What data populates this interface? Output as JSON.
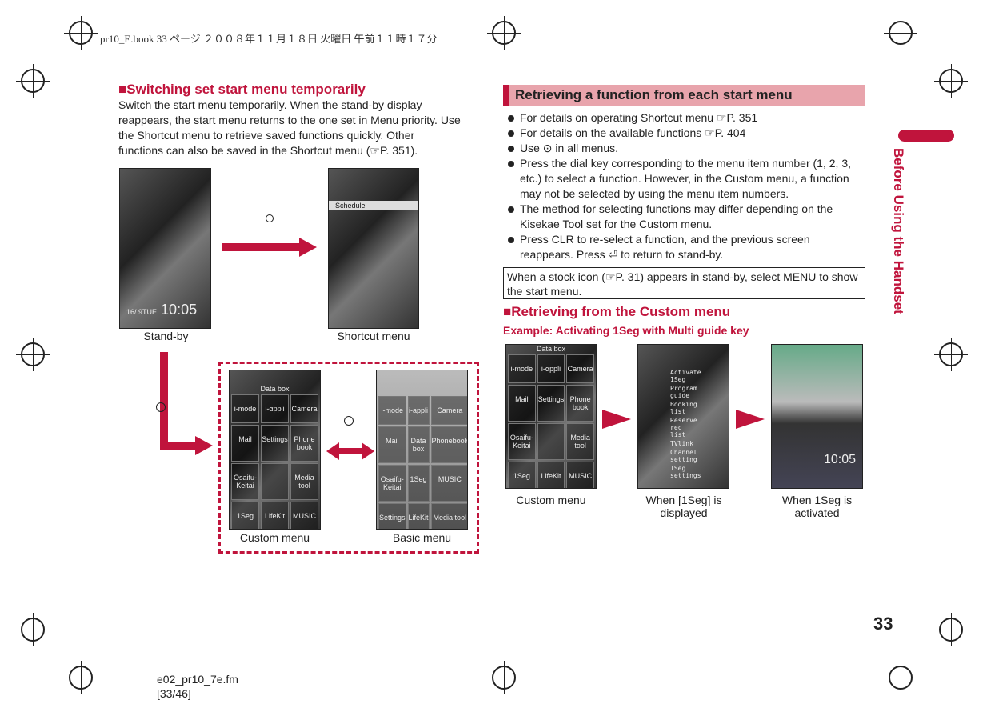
{
  "header": "pr10_E.book  33 ページ  ２００８年１１月１８日  火曜日  午前１１時１７分",
  "left": {
    "title": "■Switching set start menu temporarily",
    "body": "Switch the start menu temporarily. When the stand-by display reappears, the start menu returns to the one set in Menu priority. Use the Shortcut menu to retrieve saved functions quickly. Other functions can also be saved in the Shortcut menu (☞P. 351).",
    "captions": [
      "Stand-by",
      "Shortcut menu",
      "Custom menu",
      "Basic menu"
    ],
    "standby_time": "10:05",
    "standby_date": "16/ 9TUE",
    "shortcut_title": "Schedule",
    "custom_items": [
      "i-mode",
      "i-αppli",
      "Camera",
      "Mail",
      "Settings",
      "Phone book",
      "Osaifu-Keitai",
      "",
      "Media tool",
      "1Seg",
      "LifeKit",
      "MUSIC"
    ],
    "custom_header": "Data box",
    "basic_items": [
      "i-mode",
      "i-appli",
      "Camera",
      "Mail",
      "Data box",
      "Phonebook",
      "Osaifu-Keitai",
      "1Seg",
      "MUSIC",
      "Settings",
      "LifeKit",
      "Media tool"
    ]
  },
  "right": {
    "title": "Retrieving a function from each start menu",
    "bullets": [
      "For details on operating Shortcut menu ☞P. 351",
      "For details on the available functions ☞P. 404",
      "Use ⊙ in all menus.",
      "Press the dial key corresponding to the menu item number (1, 2, 3, etc.) to select a function. However, in the Custom menu, a function may not be selected by using the menu item numbers.",
      "The method for selecting functions may differ depending on the Kisekae Tool set for the Custom menu.",
      "Press CLR to re-select a function, and the previous screen reappears. Press ⏎ to return to stand-by."
    ],
    "note": "When a stock icon (☞P. 31) appears in stand-by, select MENU to show the start menu.",
    "subtitle": "■Retrieving from the Custom menu",
    "example": "Example: Activating 1Seg with Multi guide key",
    "captions": [
      "Custom menu",
      "When [1Seg] is displayed",
      "When 1Seg is activated"
    ],
    "seg_menu": [
      "Activate 1Seg",
      "Program guide",
      "Booking list",
      "Reserve rec list",
      "TVlink",
      "Channel setting",
      "1Seg settings"
    ],
    "seg_time": "10:05"
  },
  "side_label": "Before Using the Handset",
  "page_number": "33",
  "footer": [
    "e02_pr10_7e.fm",
    "[33/46]"
  ],
  "colors": {
    "accent": "#c0143c",
    "band": "#e8a4ac"
  }
}
